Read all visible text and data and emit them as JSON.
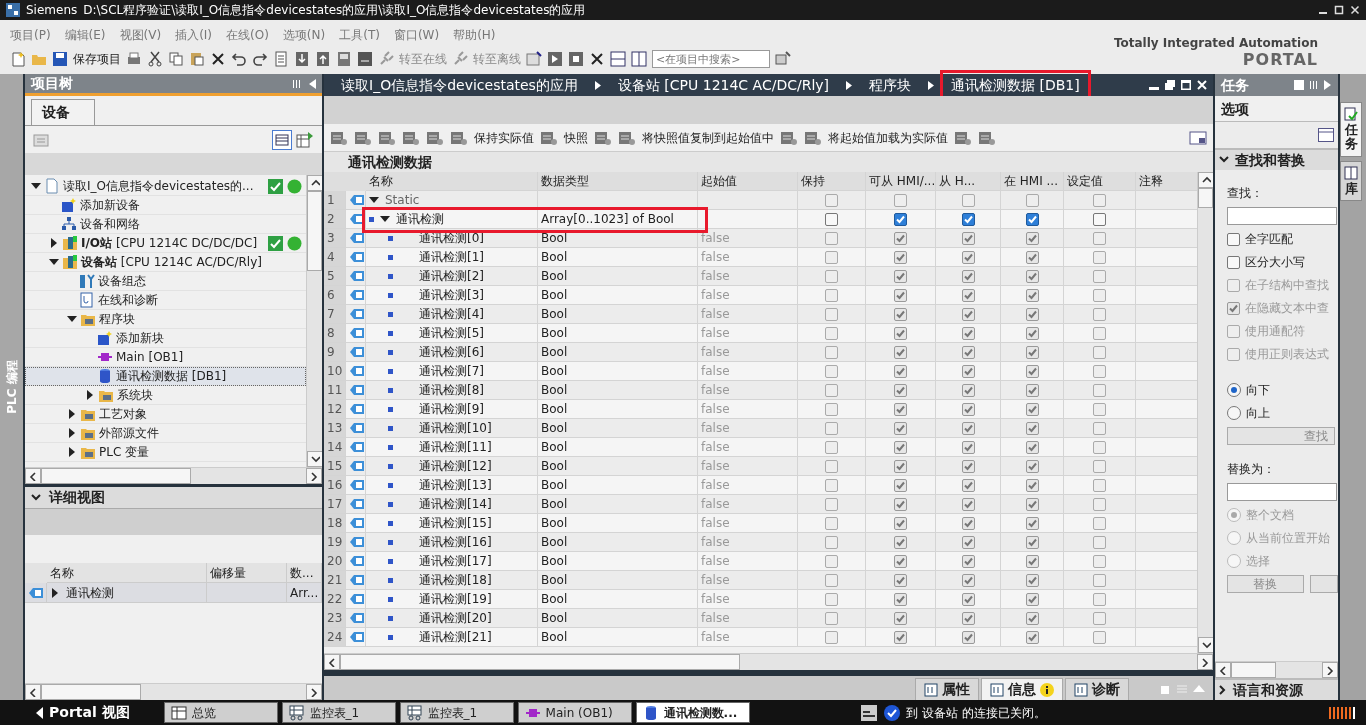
{
  "window": {
    "app": "Siemens",
    "path": "D:\\SCL程序验证\\读取I_O信息指令devicestates的应用\\读取I_O信息指令devicestates的应用"
  },
  "menu": [
    "项目(P)",
    "编辑(E)",
    "视图(V)",
    "插入(I)",
    "在线(O)",
    "选项(N)",
    "工具(T)",
    "窗口(W)",
    "帮助(H)"
  ],
  "toolbar": {
    "save": "保存项目",
    "go_online": "转至在线",
    "go_offline": "转至离线",
    "search": {
      "placeholder": "<在项目中搜索>"
    }
  },
  "brand": {
    "line1": "Totally Integrated Automation",
    "line2": "PORTAL"
  },
  "side_label": "PLC 编程",
  "project_tree": {
    "title": "项目树",
    "tab": "设备",
    "items": [
      {
        "label": "读取I_O信息指令devicestates的...",
        "kind": "project",
        "expanded": true,
        "status": true,
        "selected": false,
        "children": [
          {
            "label": "添加新设备",
            "kind": "add",
            "selected": false
          },
          {
            "label": "设备和网络",
            "kind": "network",
            "selected": false
          },
          {
            "label": "**I/O站** [CPU 1214C DC/DC/DC]",
            "kind": "plc",
            "expanded": false,
            "status": true,
            "selected": false
          },
          {
            "label": "**设备站** [CPU 1214C AC/DC/Rly]",
            "kind": "plc",
            "expanded": true,
            "selected": false,
            "children": [
              {
                "label": "设备组态",
                "kind": "config",
                "selected": false
              },
              {
                "label": "在线和诊断",
                "kind": "diag",
                "selected": false
              },
              {
                "label": "程序块",
                "kind": "folder",
                "expanded": true,
                "selected": false,
                "children": [
                  {
                    "label": "添加新块",
                    "kind": "add",
                    "selected": false
                  },
                  {
                    "label": "Main [OB1]",
                    "kind": "ob",
                    "selected": false
                  },
                  {
                    "label": "通讯检测数据 [DB1]",
                    "kind": "db",
                    "selected": true
                  },
                  {
                    "label": "系统块",
                    "kind": "folder",
                    "expanded": false,
                    "selected": false
                  }
                ]
              },
              {
                "label": "工艺对象",
                "kind": "folder",
                "expanded": false,
                "selected": false
              },
              {
                "label": "外部源文件",
                "kind": "folder",
                "expanded": false,
                "selected": false
              },
              {
                "label": "PLC 变量",
                "kind": "folder",
                "expanded": false,
                "selected": false
              }
            ]
          }
        ]
      }
    ]
  },
  "detail_view": {
    "title": "详细视图",
    "columns": [
      "名称",
      "偏移量",
      "数..."
    ],
    "rows": [
      {
        "name": "通讯检测",
        "type": "Arr..."
      }
    ]
  },
  "editor": {
    "breadcrumb": [
      {
        "label": "读取I_O信息指令devicestates的应用",
        "highlighted": false
      },
      {
        "label": "设备站 [CPU 1214C AC/DC/Rly]",
        "highlighted": false
      },
      {
        "label": "程序块",
        "highlighted": false
      },
      {
        "label": "通讯检测数据 [DB1]",
        "highlighted": true
      }
    ],
    "toolbar": [
      "保持实际值",
      "快照",
      "将快照值复制到起始值中",
      "将起始值加载为实际值"
    ],
    "block_title": "通讯检测数据",
    "columns": [
      "名称",
      "数据类型",
      "起始值",
      "保持",
      "可从 HMI/...",
      "从 H...",
      "在 HMI ...",
      "设定值",
      "注释"
    ],
    "rows": [
      {
        "num": "1",
        "kind": "struct",
        "name": "Static",
        "expanded": true,
        "highlighted": false,
        "checks": [
          {
            "checked": false,
            "disabled": true
          },
          {
            "checked": false,
            "disabled": true
          },
          {
            "checked": false,
            "disabled": true
          },
          {
            "checked": false,
            "disabled": true
          },
          {
            "checked": false,
            "disabled": true
          }
        ]
      },
      {
        "num": "2",
        "kind": "array",
        "name": "通讯检测",
        "type": "Array[0..1023] of Bool",
        "expanded": true,
        "highlighted": true,
        "checks": [
          {
            "checked": false,
            "disabled": false
          },
          {
            "checked": true,
            "disabled": false
          },
          {
            "checked": true,
            "disabled": false
          },
          {
            "checked": true,
            "disabled": false
          },
          {
            "checked": false,
            "disabled": false
          }
        ]
      },
      {
        "num": "3",
        "kind": "element",
        "name": "通讯检测[0]",
        "type": "Bool",
        "start": "false",
        "highlighted": false,
        "checks": [
          {
            "checked": false,
            "disabled": true
          },
          {
            "checked": true,
            "disabled": true
          },
          {
            "checked": true,
            "disabled": true
          },
          {
            "checked": true,
            "disabled": true
          },
          {
            "checked": false,
            "disabled": true
          }
        ]
      },
      {
        "num": "4",
        "kind": "element",
        "name": "通讯检测[1]",
        "type": "Bool",
        "start": "false",
        "highlighted": false,
        "checks": [
          {
            "checked": false,
            "disabled": true
          },
          {
            "checked": true,
            "disabled": true
          },
          {
            "checked": true,
            "disabled": true
          },
          {
            "checked": true,
            "disabled": true
          },
          {
            "checked": false,
            "disabled": true
          }
        ]
      },
      {
        "num": "5",
        "kind": "element",
        "name": "通讯检测[2]",
        "type": "Bool",
        "start": "false",
        "highlighted": false,
        "checks": [
          {
            "checked": false,
            "disabled": true
          },
          {
            "checked": true,
            "disabled": true
          },
          {
            "checked": true,
            "disabled": true
          },
          {
            "checked": true,
            "disabled": true
          },
          {
            "checked": false,
            "disabled": true
          }
        ]
      },
      {
        "num": "6",
        "kind": "element",
        "name": "通讯检测[3]",
        "type": "Bool",
        "start": "false",
        "highlighted": false,
        "checks": [
          {
            "checked": false,
            "disabled": true
          },
          {
            "checked": true,
            "disabled": true
          },
          {
            "checked": true,
            "disabled": true
          },
          {
            "checked": true,
            "disabled": true
          },
          {
            "checked": false,
            "disabled": true
          }
        ]
      },
      {
        "num": "7",
        "kind": "element",
        "name": "通讯检测[4]",
        "type": "Bool",
        "start": "false",
        "highlighted": false,
        "checks": [
          {
            "checked": false,
            "disabled": true
          },
          {
            "checked": true,
            "disabled": true
          },
          {
            "checked": true,
            "disabled": true
          },
          {
            "checked": true,
            "disabled": true
          },
          {
            "checked": false,
            "disabled": true
          }
        ]
      },
      {
        "num": "8",
        "kind": "element",
        "name": "通讯检测[5]",
        "type": "Bool",
        "start": "false",
        "highlighted": false,
        "checks": [
          {
            "checked": false,
            "disabled": true
          },
          {
            "checked": true,
            "disabled": true
          },
          {
            "checked": true,
            "disabled": true
          },
          {
            "checked": true,
            "disabled": true
          },
          {
            "checked": false,
            "disabled": true
          }
        ]
      },
      {
        "num": "9",
        "kind": "element",
        "name": "通讯检测[6]",
        "type": "Bool",
        "start": "false",
        "highlighted": false,
        "checks": [
          {
            "checked": false,
            "disabled": true
          },
          {
            "checked": true,
            "disabled": true
          },
          {
            "checked": true,
            "disabled": true
          },
          {
            "checked": true,
            "disabled": true
          },
          {
            "checked": false,
            "disabled": true
          }
        ]
      },
      {
        "num": "10",
        "kind": "element",
        "name": "通讯检测[7]",
        "type": "Bool",
        "start": "false",
        "highlighted": false,
        "checks": [
          {
            "checked": false,
            "disabled": true
          },
          {
            "checked": true,
            "disabled": true
          },
          {
            "checked": true,
            "disabled": true
          },
          {
            "checked": true,
            "disabled": true
          },
          {
            "checked": false,
            "disabled": true
          }
        ]
      },
      {
        "num": "11",
        "kind": "element",
        "name": "通讯检测[8]",
        "type": "Bool",
        "start": "false",
        "highlighted": false,
        "checks": [
          {
            "checked": false,
            "disabled": true
          },
          {
            "checked": true,
            "disabled": true
          },
          {
            "checked": true,
            "disabled": true
          },
          {
            "checked": true,
            "disabled": true
          },
          {
            "checked": false,
            "disabled": true
          }
        ]
      },
      {
        "num": "12",
        "kind": "element",
        "name": "通讯检测[9]",
        "type": "Bool",
        "start": "false",
        "highlighted": false,
        "checks": [
          {
            "checked": false,
            "disabled": true
          },
          {
            "checked": true,
            "disabled": true
          },
          {
            "checked": true,
            "disabled": true
          },
          {
            "checked": true,
            "disabled": true
          },
          {
            "checked": false,
            "disabled": true
          }
        ]
      },
      {
        "num": "13",
        "kind": "element",
        "name": "通讯检测[10]",
        "type": "Bool",
        "start": "false",
        "highlighted": false,
        "checks": [
          {
            "checked": false,
            "disabled": true
          },
          {
            "checked": true,
            "disabled": true
          },
          {
            "checked": true,
            "disabled": true
          },
          {
            "checked": true,
            "disabled": true
          },
          {
            "checked": false,
            "disabled": true
          }
        ]
      },
      {
        "num": "14",
        "kind": "element",
        "name": "通讯检测[11]",
        "type": "Bool",
        "start": "false",
        "highlighted": false,
        "checks": [
          {
            "checked": false,
            "disabled": true
          },
          {
            "checked": true,
            "disabled": true
          },
          {
            "checked": true,
            "disabled": true
          },
          {
            "checked": true,
            "disabled": true
          },
          {
            "checked": false,
            "disabled": true
          }
        ]
      },
      {
        "num": "15",
        "kind": "element",
        "name": "通讯检测[12]",
        "type": "Bool",
        "start": "false",
        "highlighted": false,
        "checks": [
          {
            "checked": false,
            "disabled": true
          },
          {
            "checked": true,
            "disabled": true
          },
          {
            "checked": true,
            "disabled": true
          },
          {
            "checked": true,
            "disabled": true
          },
          {
            "checked": false,
            "disabled": true
          }
        ]
      },
      {
        "num": "16",
        "kind": "element",
        "name": "通讯检测[13]",
        "type": "Bool",
        "start": "false",
        "highlighted": false,
        "checks": [
          {
            "checked": false,
            "disabled": true
          },
          {
            "checked": true,
            "disabled": true
          },
          {
            "checked": true,
            "disabled": true
          },
          {
            "checked": true,
            "disabled": true
          },
          {
            "checked": false,
            "disabled": true
          }
        ]
      },
      {
        "num": "17",
        "kind": "element",
        "name": "通讯检测[14]",
        "type": "Bool",
        "start": "false",
        "highlighted": false,
        "checks": [
          {
            "checked": false,
            "disabled": true
          },
          {
            "checked": true,
            "disabled": true
          },
          {
            "checked": true,
            "disabled": true
          },
          {
            "checked": true,
            "disabled": true
          },
          {
            "checked": false,
            "disabled": true
          }
        ]
      },
      {
        "num": "18",
        "kind": "element",
        "name": "通讯检测[15]",
        "type": "Bool",
        "start": "false",
        "highlighted": false,
        "checks": [
          {
            "checked": false,
            "disabled": true
          },
          {
            "checked": true,
            "disabled": true
          },
          {
            "checked": true,
            "disabled": true
          },
          {
            "checked": true,
            "disabled": true
          },
          {
            "checked": false,
            "disabled": true
          }
        ]
      },
      {
        "num": "19",
        "kind": "element",
        "name": "通讯检测[16]",
        "type": "Bool",
        "start": "false",
        "highlighted": false,
        "checks": [
          {
            "checked": false,
            "disabled": true
          },
          {
            "checked": true,
            "disabled": true
          },
          {
            "checked": true,
            "disabled": true
          },
          {
            "checked": true,
            "disabled": true
          },
          {
            "checked": false,
            "disabled": true
          }
        ]
      },
      {
        "num": "20",
        "kind": "element",
        "name": "通讯检测[17]",
        "type": "Bool",
        "start": "false",
        "highlighted": false,
        "checks": [
          {
            "checked": false,
            "disabled": true
          },
          {
            "checked": true,
            "disabled": true
          },
          {
            "checked": true,
            "disabled": true
          },
          {
            "checked": true,
            "disabled": true
          },
          {
            "checked": false,
            "disabled": true
          }
        ]
      },
      {
        "num": "21",
        "kind": "element",
        "name": "通讯检测[18]",
        "type": "Bool",
        "start": "false",
        "highlighted": false,
        "checks": [
          {
            "checked": false,
            "disabled": true
          },
          {
            "checked": true,
            "disabled": true
          },
          {
            "checked": true,
            "disabled": true
          },
          {
            "checked": true,
            "disabled": true
          },
          {
            "checked": false,
            "disabled": true
          }
        ]
      },
      {
        "num": "22",
        "kind": "element",
        "name": "通讯检测[19]",
        "type": "Bool",
        "start": "false",
        "highlighted": false,
        "checks": [
          {
            "checked": false,
            "disabled": true
          },
          {
            "checked": true,
            "disabled": true
          },
          {
            "checked": true,
            "disabled": true
          },
          {
            "checked": true,
            "disabled": true
          },
          {
            "checked": false,
            "disabled": true
          }
        ]
      },
      {
        "num": "23",
        "kind": "element",
        "name": "通讯检测[20]",
        "type": "Bool",
        "start": "false",
        "highlighted": false,
        "checks": [
          {
            "checked": false,
            "disabled": true
          },
          {
            "checked": true,
            "disabled": true
          },
          {
            "checked": true,
            "disabled": true
          },
          {
            "checked": true,
            "disabled": true
          },
          {
            "checked": false,
            "disabled": true
          }
        ]
      },
      {
        "num": "24",
        "kind": "element",
        "name": "通讯检测[21]",
        "type": "Bool",
        "start": "false",
        "highlighted": false,
        "checks": [
          {
            "checked": false,
            "disabled": true
          },
          {
            "checked": true,
            "disabled": true
          },
          {
            "checked": true,
            "disabled": true
          },
          {
            "checked": true,
            "disabled": true
          },
          {
            "checked": false,
            "disabled": true
          }
        ]
      }
    ]
  },
  "inspector_tabs": [
    {
      "label": "属性",
      "selected": false,
      "badge": false
    },
    {
      "label": "信息",
      "selected": true,
      "badge": true
    },
    {
      "label": "诊断",
      "selected": false,
      "badge": false
    }
  ],
  "task_panel": {
    "title": "任务",
    "options": "选项",
    "section": "查找和替换",
    "find_label": "查找：",
    "checks": [
      {
        "label": "全字匹配",
        "checked": false,
        "disabled": false
      },
      {
        "label": "区分大小写",
        "checked": false,
        "disabled": false
      },
      {
        "label": "在子结构中查找",
        "checked": false,
        "disabled": true
      },
      {
        "label": "在隐藏文本中查",
        "checked": true,
        "disabled": true
      },
      {
        "label": "使用通配符",
        "checked": false,
        "disabled": true
      },
      {
        "label": "使用正则表达式",
        "checked": false,
        "disabled": true
      }
    ],
    "direction": [
      {
        "label": "向下",
        "selected": true,
        "disabled": false
      },
      {
        "label": "向上",
        "selected": false,
        "disabled": false
      }
    ],
    "find_button": "查找",
    "replace_label": "替换为：",
    "scope": [
      {
        "label": "整个文档",
        "selected": true,
        "disabled": true
      },
      {
        "label": "从当前位置开始",
        "selected": false,
        "disabled": true
      },
      {
        "label": "选择",
        "selected": false,
        "disabled": true
      }
    ],
    "replace_button": "替换",
    "next_section": "语言和资源"
  },
  "side_tabs": [
    {
      "label": "任务",
      "selected": true
    },
    {
      "label": "库",
      "selected": false
    }
  ],
  "taskbar": {
    "portal": "Portal 视图",
    "items": [
      {
        "label": "总览",
        "kind": "overview",
        "selected": false
      },
      {
        "label": "监控表_1",
        "kind": "watch",
        "selected": false
      },
      {
        "label": "监控表_1",
        "kind": "watch",
        "selected": false
      },
      {
        "label": "Main (OB1)",
        "kind": "ob",
        "selected": false
      },
      {
        "label": "通讯检测数...",
        "kind": "db",
        "selected": true
      }
    ],
    "status": "到 设备站 的连接已关闭。"
  }
}
